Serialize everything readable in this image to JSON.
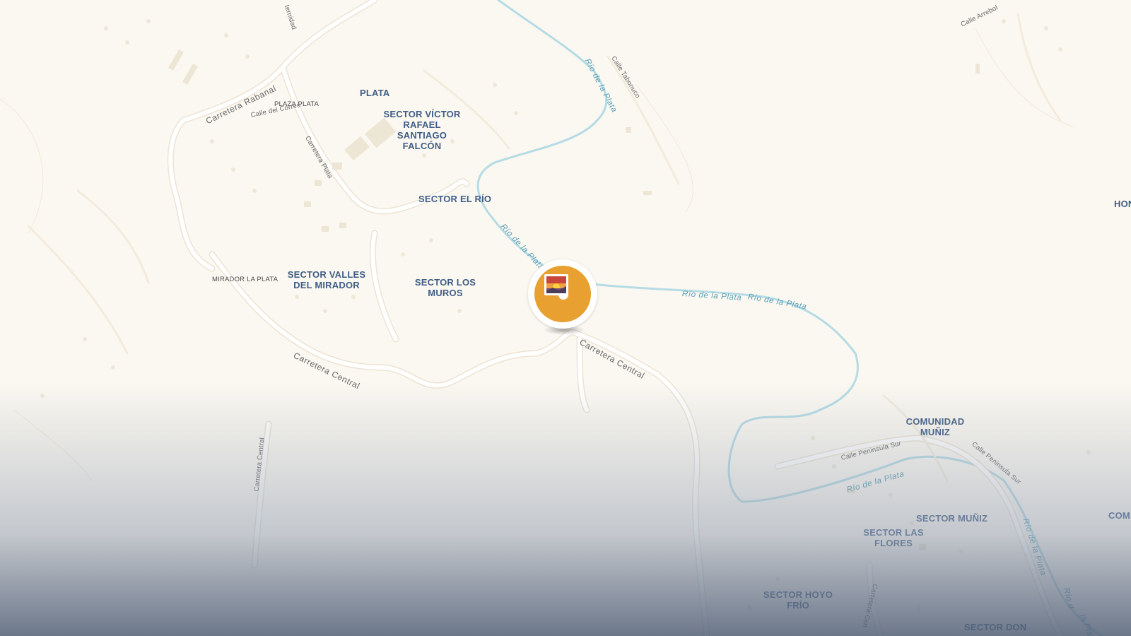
{
  "map": {
    "colors": {
      "land": "#fbf8f1",
      "road": "#ffffff",
      "road_edge": "#ece4d3",
      "river": "#b5dbe5",
      "label_place": "#3f5d86",
      "label_river": "#5b9fb6",
      "marker": "#e8a030"
    },
    "places": {
      "plata": "PLATA",
      "sector_victor_1": "SECTOR VÍCTOR",
      "sector_victor_2": "RAFAEL",
      "sector_victor_3": "SANTIAGO",
      "sector_victor_4": "FALCÓN",
      "sector_el_rio": "SECTOR EL RÍO",
      "sector_valles_1": "SECTOR VALLES",
      "sector_valles_2": "DEL MIRADOR",
      "sector_los_muros_1": "SECTOR LOS",
      "sector_los_muros_2": "MUROS",
      "comunidad_muniz_1": "COMUNIDAD",
      "comunidad_muniz_2": "MUÑIZ",
      "sector_muniz": "SECTOR MUÑIZ",
      "sector_las_flores_1": "SECTOR LAS",
      "sector_las_flores_2": "FLORES",
      "sector_hoyo_frio_1": "SECTOR HOYO",
      "sector_hoyo_frio_2": "FRÍO",
      "sector_don": "SECTOR DON",
      "hon": "HON",
      "com": "COM"
    },
    "pois": {
      "plaza_plata": "PLAZA PLATA",
      "mirador_la_plata": "MIRADOR LA PLATA"
    },
    "roads": {
      "carretera_rabanal": "Carretera Rabanal",
      "calle_del_correo": "Calle del Correo",
      "carretera_plata": "Carretera Plata",
      "carretera_central_a": "Carretera Central",
      "carretera_central_b": "Carretera Central",
      "carretera_central_c": "Carretera Central",
      "carretera_central_d": "Carretera Cen",
      "calle_tabonuco": "Calle Tabonuco",
      "calle_arrebol": "Calle Arrebol",
      "calle_peninsula_sur_a": "Calle Peninsula Sur",
      "calle_peninsula_sur_b": "Calle Peninsula Sur",
      "fraternidad": "ternidad"
    },
    "rivers": {
      "r1": "Río de la Plata",
      "r2": "Río de la Plata",
      "r3": "Río de la Plata",
      "r4": "Río de la Plata",
      "r5": "Río de la Plata",
      "r6": "Río de la Plata",
      "r7": "Río d",
      "r8": "la Plata"
    },
    "marker": {
      "icon": "photo-icon"
    }
  }
}
